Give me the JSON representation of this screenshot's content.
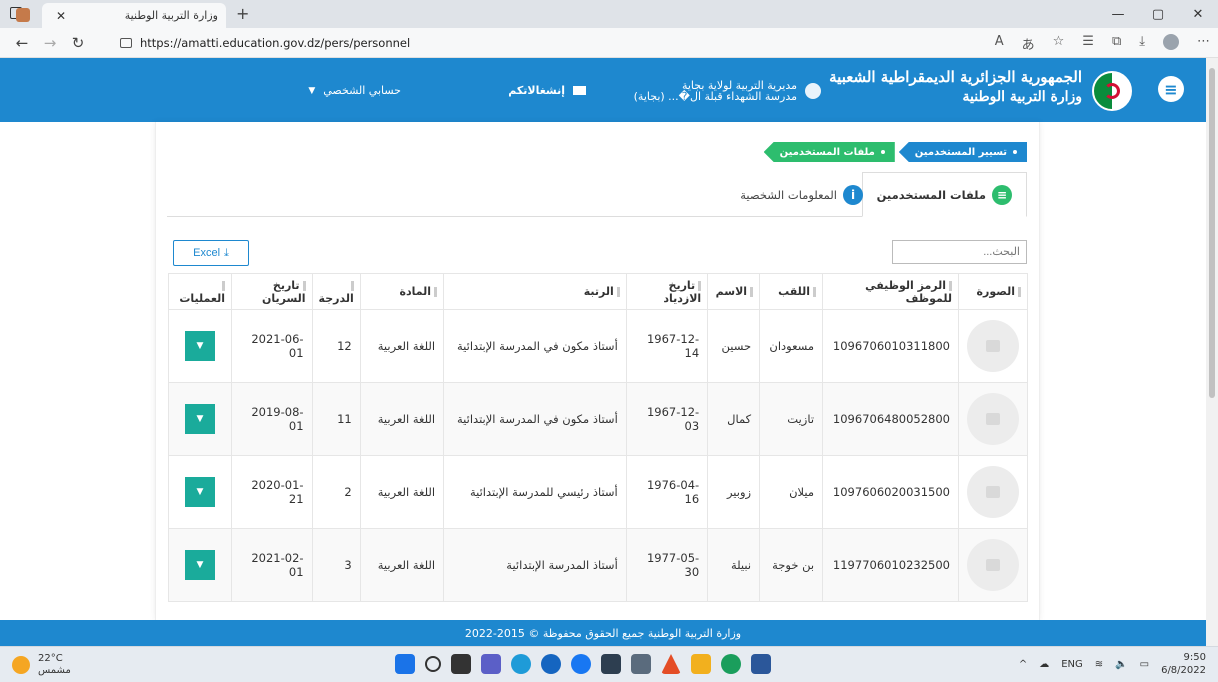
{
  "browser": {
    "tab_title": "وزارة التربية الوطنية",
    "tab_close": "✕",
    "new_tab": "+",
    "url": "https://amatti.education.gov.dz/pers/personnel",
    "win_min": "—",
    "win_max": "▢",
    "win_close": "✕"
  },
  "header": {
    "brand_line1": "الجمهورية الجزائرية الديمقراطية الشعبية",
    "brand_line2": "وزارة التربية الوطنية",
    "directorate_line1": "مديرية التربية لولاية بجاية",
    "directorate_line2": "مدرسة الشهداء قبلة ال�... (بجاية)",
    "notifications": "إنشغالاتكم",
    "account": "حسابي الشخصي",
    "menu_icon": "menu-icon"
  },
  "breadcrumb": {
    "items": [
      "تسيير المستخدمين",
      "ملفات المستخدمين"
    ]
  },
  "tabs": {
    "active": "ملفات المستخدمين",
    "inactive": "المعلومات الشخصية"
  },
  "toolbar": {
    "search_placeholder": "البحث...",
    "excel_label": "Excel"
  },
  "table": {
    "headers": [
      "الصورة",
      "الرمز الوظيفي للموظف",
      "اللقب",
      "الاسم",
      "تاريخ الازدياد",
      "الرتبة",
      "المادة",
      "الدرجة",
      "تاريخ السريان",
      "العمليات"
    ],
    "rows": [
      {
        "code": "1096706010311800",
        "surname": "مسعودان",
        "name": "حسين",
        "birth": "1967-12-14",
        "rank": "أستاذ مكون في المدرسة الإبتدائية",
        "subject": "اللغة العربية",
        "grade": "12",
        "effective": "2021-06-01"
      },
      {
        "code": "1096706480052800",
        "surname": "تازيت",
        "name": "كمال",
        "birth": "1967-12-03",
        "rank": "أستاذ مكون في المدرسة الإبتدائية",
        "subject": "اللغة العربية",
        "grade": "11",
        "effective": "2019-08-01"
      },
      {
        "code": "1097606020031500",
        "surname": "ميلان",
        "name": "زوبير",
        "birth": "1976-04-16",
        "rank": "أستاذ رئيسي للمدرسة الإبتدائية",
        "subject": "اللغة العربية",
        "grade": "2",
        "effective": "2020-01-21"
      },
      {
        "code": "1197706010232500",
        "surname": "بن خوجة",
        "name": "نبيلة",
        "birth": "1977-05-30",
        "rank": "أستاذ المدرسة الإبتدائية",
        "subject": "اللغة العربية",
        "grade": "3",
        "effective": "2021-02-01"
      }
    ]
  },
  "footer": {
    "text": "وزارة التربية الوطنية جميع الحقوق محفوظة © 2015-2022"
  },
  "taskbar": {
    "temp": "22°C",
    "weather": "مشمس",
    "lang": "ENG",
    "time": "9:50",
    "date": "6/8/2022"
  }
}
